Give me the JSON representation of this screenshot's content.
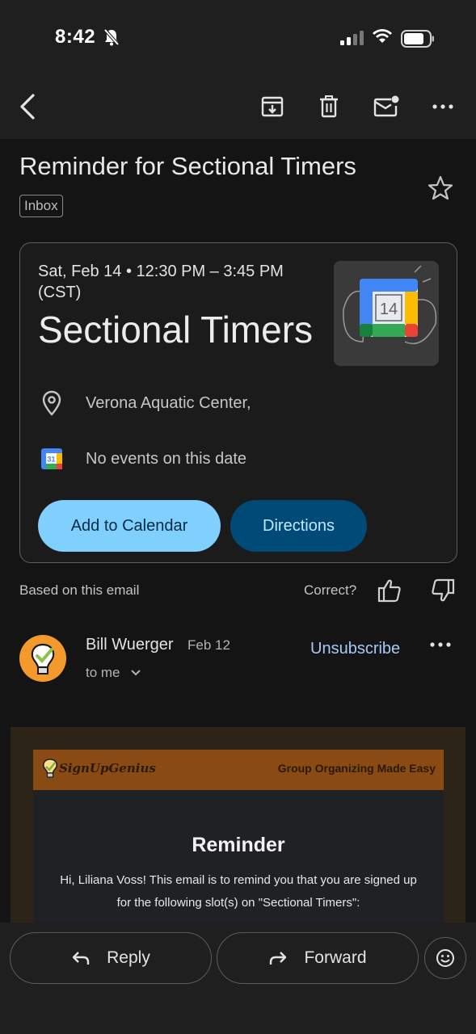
{
  "status_bar": {
    "time": "8:42"
  },
  "toolbar": {
    "icons": [
      "back-arrow-icon",
      "archive-icon",
      "trash-icon",
      "mark-unread-icon",
      "more-icon"
    ]
  },
  "email": {
    "subject": "Reminder for Sectional Timers",
    "label": "Inbox",
    "starred": false
  },
  "event_card": {
    "date_time": "Sat, Feb 14 • 12:30 PM – 3:45 PM (CST)",
    "title": "Sectional Timers",
    "calendar_day": "14",
    "location": "Verona Aquatic Center,",
    "calendar_status": "No events on this date",
    "calendar_icon_day": "31",
    "add_button": "Add to Calendar",
    "directions_button": "Directions"
  },
  "feedback": {
    "label": "Based on this email",
    "question": "Correct?"
  },
  "sender": {
    "name": "Bill Wuerger",
    "date": "Feb 12",
    "recipient": "to me",
    "unsubscribe": "Unsubscribe"
  },
  "email_body": {
    "brand": "SignUpGenius",
    "tagline": "Group Organizing Made Easy",
    "heading": "Reminder",
    "text": "Hi, Liliana Voss! This email is to remind you that you are signed up for the following slot(s) on \"Sectional Timers\":"
  },
  "bottom_actions": {
    "reply": "Reply",
    "forward": "Forward"
  },
  "colors": {
    "background": "#1f1f1f",
    "primary_button": "#7fcfff",
    "secondary_button": "#004a77",
    "link": "#a8c7fa",
    "brand_header": "#8a4a13"
  }
}
